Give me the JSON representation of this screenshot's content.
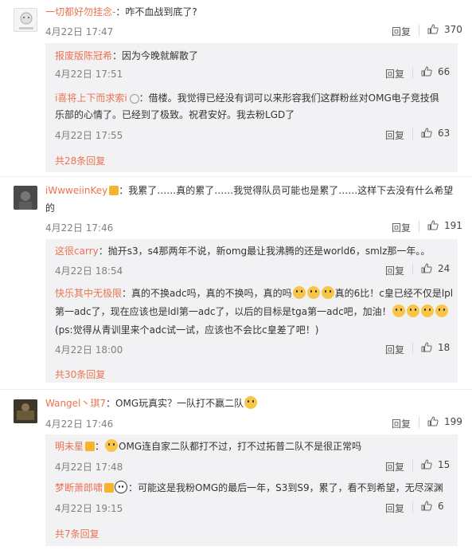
{
  "actions": {
    "reply_label": "回复"
  },
  "threads": [
    {
      "user": "一切都好勿挂念-",
      "text": "：咋不血战到底了?",
      "time": "4月22日 17:47",
      "likes": "370",
      "replies": [
        {
          "user": "报废版陈冠希",
          "text": "：因为今晚就解散了",
          "time": "4月22日 17:51",
          "likes": "66"
        },
        {
          "user": "i喜将上下而求索i",
          "text_line1": "：借楼。我觉得已经没有词可以来形容我们这群粉丝对OMG电子竞技俱",
          "text_line2": "乐部的心情了。已经到了极致。祝君安好。我去粉LGD了",
          "time": "4月22日 17:55",
          "likes": "63"
        }
      ],
      "more": "共28条回复"
    },
    {
      "user": "iWwweiinKey",
      "text_line1": "：我累了……真的累了……我觉得队员可能也是累了……这样下去没有什么希望",
      "text_line2": "的",
      "time": "4月22日 17:46",
      "likes": "191",
      "replies": [
        {
          "user": "这很carry",
          "text": "：抛开s3，s4那两年不说，新omg最让我沸腾的还是world6，smlz那一年。。",
          "time": "4月22日 18:54",
          "likes": "24"
        },
        {
          "user": "快乐其中无极限",
          "text_line1a": "：真的不换adc吗，真的不换吗，真的吗",
          "text_line1b": "真的6比！c皇已经不仅是lpl",
          "text_line2": "第一adc了，现在应该也是ldl第一adc了，以后的目标是tga第一adc吧，加油！",
          "text_line3": "(ps:觉得从青训里来个adc试一试，应该也不会比c皇差了吧！)",
          "time": "4月22日 18:00",
          "likes": "18"
        }
      ],
      "more": "共30条回复"
    },
    {
      "user": "Wangel丶琪7",
      "text": "：OMG玩真实？一队打不赢二队",
      "time": "4月22日 17:46",
      "likes": "199",
      "replies": [
        {
          "user": "明未星",
          "text": "OMG连自家二队都打不过，打不过拓普二队不是很正常吗",
          "time": "4月22日 17:48",
          "likes": "15"
        },
        {
          "user": "梦断萧郎啸",
          "text": "：可能这是我粉OMG的最后一年，S3到S9，累了，看不到希望，无尽深渊",
          "time": "4月22日 19:15",
          "likes": "6"
        }
      ],
      "more": "共7条回复"
    }
  ],
  "colors": {
    "accent": "#eb7350",
    "reply_bg": "#f2f2f5",
    "meta": "#808080"
  }
}
